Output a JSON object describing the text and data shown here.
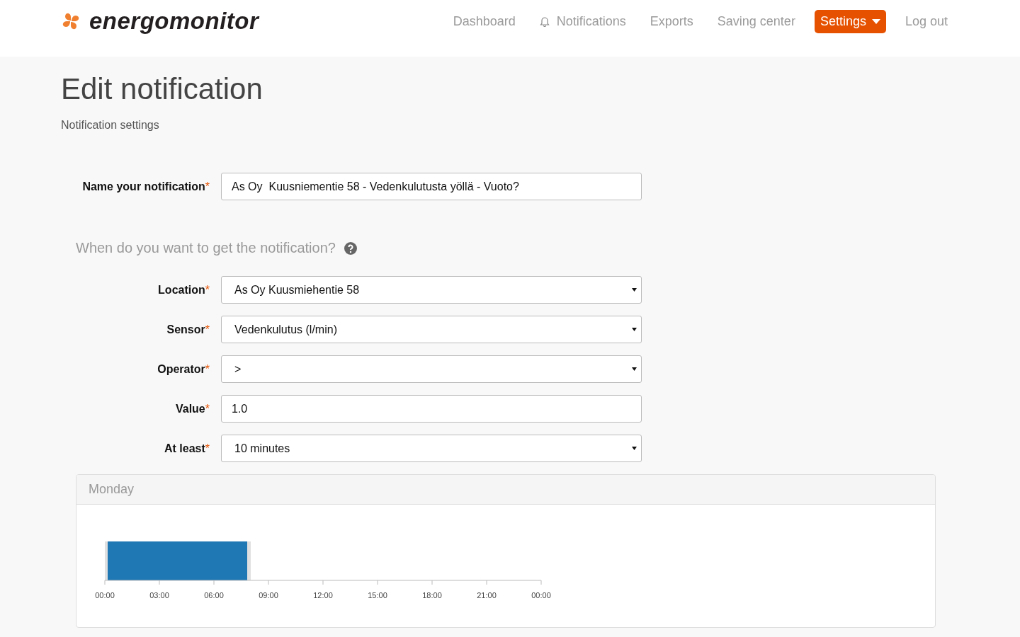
{
  "brand": "energomonitor",
  "nav": [
    {
      "label": "Dashboard",
      "kind": "link",
      "selected": false
    },
    {
      "label": "Notifications",
      "kind": "bell",
      "selected": false
    },
    {
      "label": "Exports",
      "kind": "link",
      "selected": false
    },
    {
      "label": "Saving center",
      "kind": "link",
      "selected": false
    },
    {
      "label": "Settings",
      "kind": "dropdown",
      "selected": true
    },
    {
      "label": "Log out",
      "kind": "link",
      "selected": false
    }
  ],
  "title": "Edit notification",
  "subtitle": "Notification settings",
  "name_field": {
    "label": "Name your notification",
    "required_mark": "*",
    "value": "As Oy  Kuusniementie 58 - Vedenkulutusta yöllä - Vuoto?"
  },
  "section_title": "When do you want to get the notification?",
  "fields": [
    {
      "label": "Location",
      "required_mark": "*",
      "kind": "select",
      "value": "As Oy Kuusmiehentie 58"
    },
    {
      "label": "Sensor",
      "required_mark": "*",
      "kind": "select",
      "value": "Vedenkulutus (l/min)"
    },
    {
      "label": "Operator",
      "required_mark": "*",
      "kind": "select",
      "value": ">"
    },
    {
      "label": "Value",
      "required_mark": "*",
      "kind": "input",
      "value": "1.0"
    },
    {
      "label": "At least",
      "required_mark": "*",
      "kind": "select",
      "value": "10 minutes"
    }
  ],
  "schedule": {
    "day": "Monday",
    "ticks": [
      "00:00",
      "03:00",
      "06:00",
      "09:00",
      "12:00",
      "15:00",
      "18:00",
      "21:00",
      "00:00"
    ]
  }
}
